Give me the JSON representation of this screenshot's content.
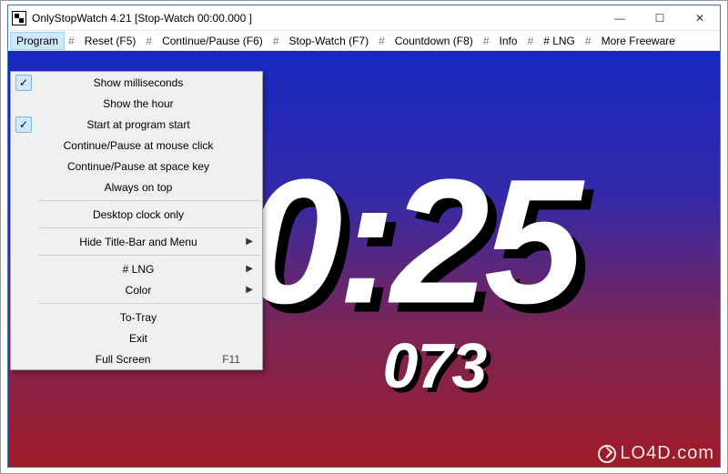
{
  "title": "OnlyStopWatch 4.21    [Stop-Watch  00:00.000 ]",
  "window_controls": {
    "min": "—",
    "max": "☐",
    "close": "✕"
  },
  "menubar": {
    "program": "Program",
    "reset": "Reset  (F5)",
    "continue_pause": "Continue/Pause (F6)",
    "stop_watch": "Stop-Watch  (F7)",
    "countdown": "Countdown  (F8)",
    "info": "Info",
    "lng": "# LNG",
    "more": "More Freeware"
  },
  "program_menu": {
    "show_ms": {
      "label": "Show milliseconds",
      "checked": true,
      "submenu": false,
      "accel": ""
    },
    "show_hour": {
      "label": "Show the hour",
      "checked": false,
      "submenu": false,
      "accel": ""
    },
    "start_at_start": {
      "label": "Start at program start",
      "checked": true,
      "submenu": false,
      "accel": ""
    },
    "cp_mouse": {
      "label": "Continue/Pause at mouse click",
      "checked": false,
      "submenu": false,
      "accel": ""
    },
    "cp_space": {
      "label": "Continue/Pause at space key",
      "checked": false,
      "submenu": false,
      "accel": ""
    },
    "always_top": {
      "label": "Always on top",
      "checked": false,
      "submenu": false,
      "accel": ""
    },
    "desktop_only": {
      "label": "Desktop clock only",
      "checked": false,
      "submenu": false,
      "accel": ""
    },
    "hide_titlebar": {
      "label": "Hide Title-Bar and Menu",
      "checked": false,
      "submenu": true,
      "accel": ""
    },
    "lng": {
      "label": "# LNG",
      "checked": false,
      "submenu": true,
      "accel": ""
    },
    "color": {
      "label": "Color",
      "checked": false,
      "submenu": true,
      "accel": ""
    },
    "to_tray": {
      "label": "To-Tray",
      "checked": false,
      "submenu": false,
      "accel": ""
    },
    "exit": {
      "label": "Exit",
      "checked": false,
      "submenu": false,
      "accel": ""
    },
    "full_screen": {
      "label": "Full Screen",
      "checked": false,
      "submenu": false,
      "accel": "F11"
    }
  },
  "timer": {
    "main": "00:25",
    "ms": "073"
  },
  "watermark": "LO4D.com"
}
